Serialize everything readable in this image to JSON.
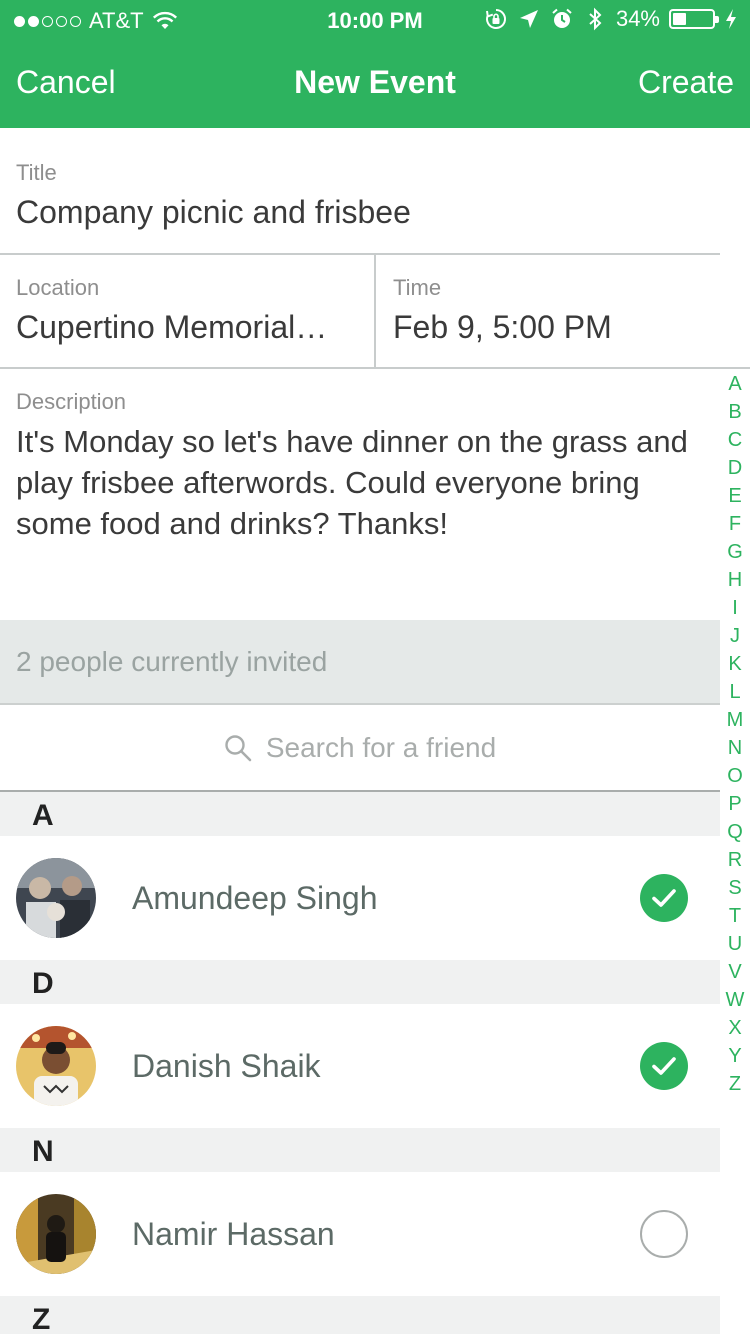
{
  "status_bar": {
    "carrier": "AT&T",
    "time": "10:00 PM",
    "battery_percent": "34%",
    "battery_level": 0.34,
    "signal_bars_filled": 2,
    "signal_bars_total": 5
  },
  "nav": {
    "cancel_label": "Cancel",
    "title": "New Event",
    "create_label": "Create"
  },
  "form": {
    "title_label": "Title",
    "title_value": "Company picnic and frisbee",
    "location_label": "Location",
    "location_value": "Cupertino Memorial…",
    "time_label": "Time",
    "time_value": "Feb 9, 5:00 PM",
    "description_label": "Description",
    "description_value": "It's Monday so let's have dinner on the grass and play frisbee afterwords. Could everyone bring some food and drinks? Thanks!"
  },
  "invited_text": "2 people currently invited",
  "search": {
    "placeholder": "Search for a friend",
    "icon": "search-icon"
  },
  "sections": [
    {
      "letter": "A",
      "friends": [
        {
          "name": "Amundeep Singh",
          "selected": true
        }
      ]
    },
    {
      "letter": "D",
      "friends": [
        {
          "name": "Danish Shaik",
          "selected": true
        }
      ]
    },
    {
      "letter": "N",
      "friends": [
        {
          "name": "Namir Hassan",
          "selected": false
        }
      ]
    },
    {
      "letter": "Z",
      "friends": []
    }
  ],
  "alphabet_index": [
    "A",
    "B",
    "C",
    "D",
    "E",
    "F",
    "G",
    "H",
    "I",
    "J",
    "K",
    "L",
    "M",
    "N",
    "O",
    "P",
    "Q",
    "R",
    "S",
    "T",
    "U",
    "V",
    "W",
    "X",
    "Y",
    "Z"
  ],
  "colors": {
    "brand_green": "#2DB35F",
    "text_gray": "#5C6A66",
    "label_gray": "#8E8E8E",
    "invited_bg": "#E5E9E8"
  }
}
